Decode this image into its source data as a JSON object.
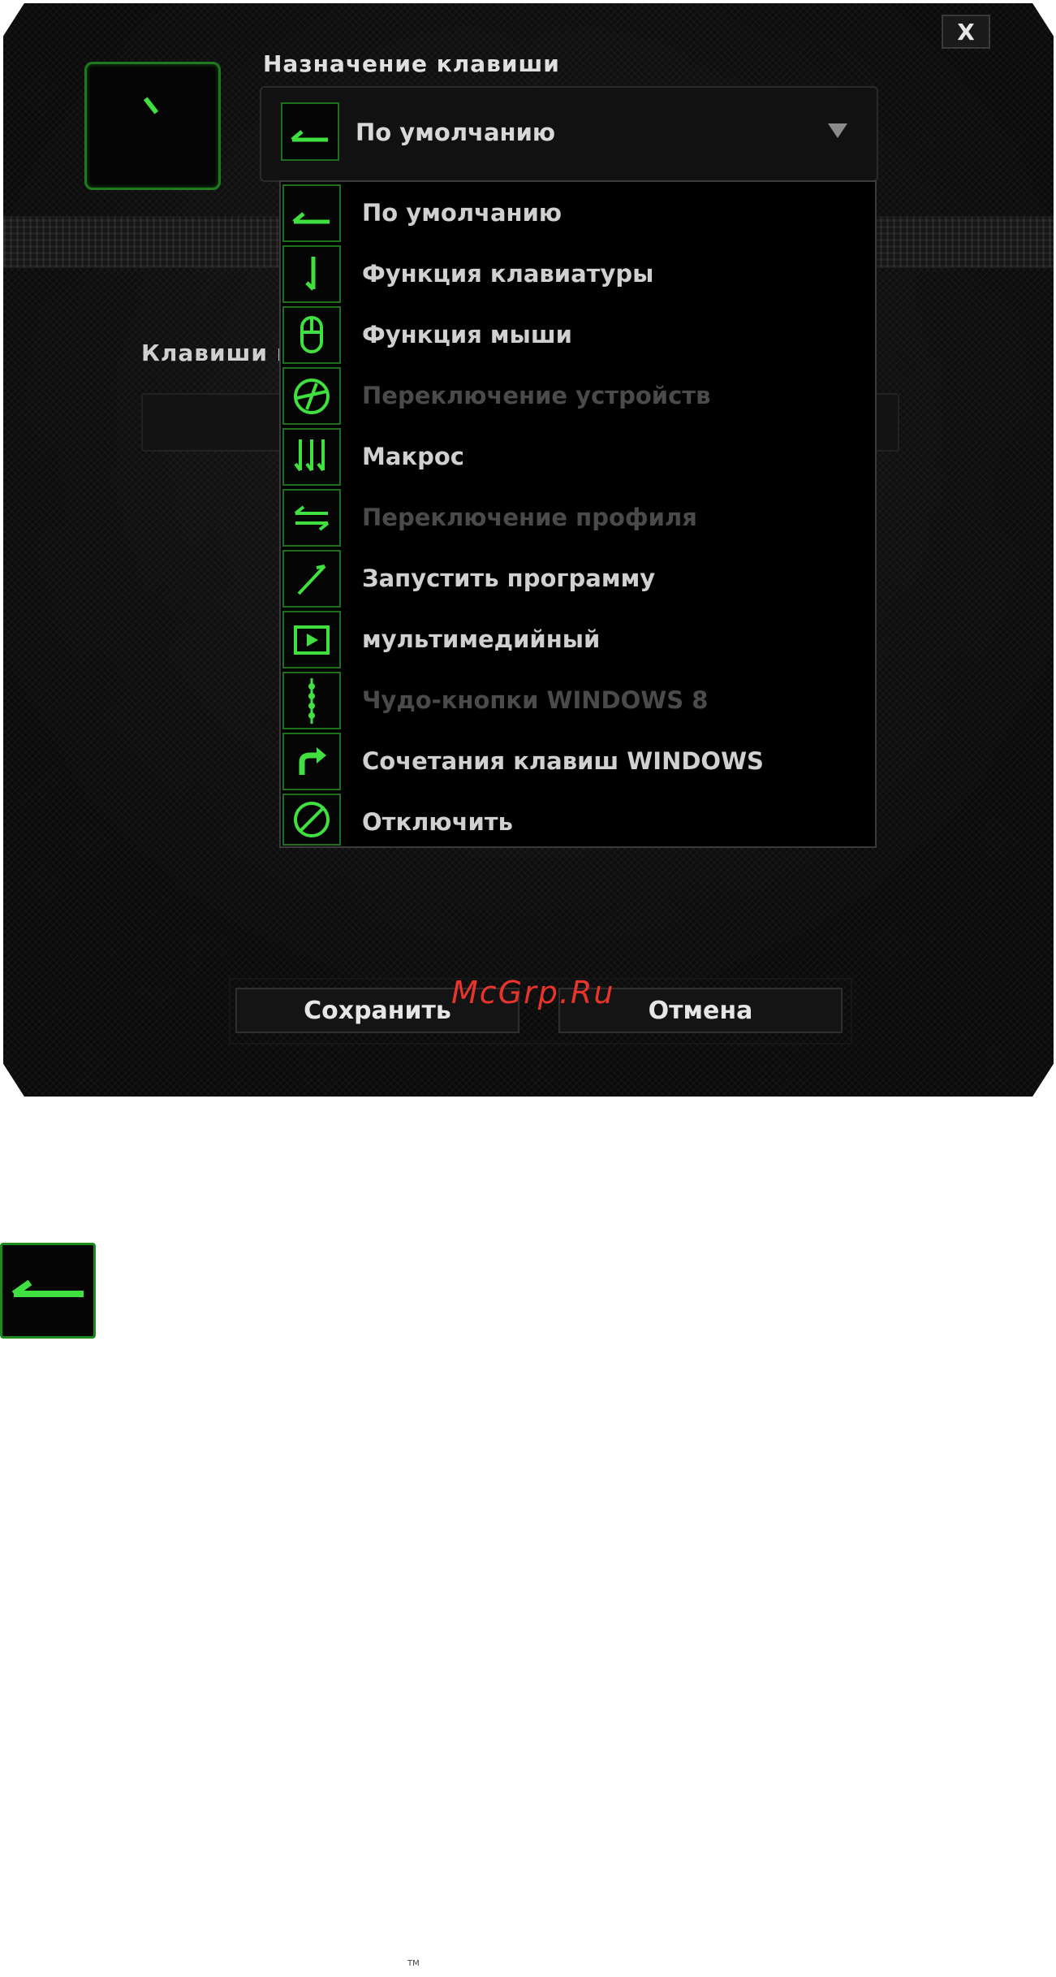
{
  "dialog": {
    "close_label": "X",
    "assign_title": "Назначение клавиши",
    "selected_value": "По умолчанию",
    "section_label": "Клавиши по",
    "save_label": "Сохранить",
    "cancel_label": "Отмена"
  },
  "menu": {
    "items": [
      {
        "label": "По умолчанию",
        "icon": "default-arrow-icon",
        "enabled": true
      },
      {
        "label": "Функция клавиатуры",
        "icon": "keyboard-function-icon",
        "enabled": true
      },
      {
        "label": "Функция мыши",
        "icon": "mouse-icon",
        "enabled": true
      },
      {
        "label": "Переключение устройств",
        "icon": "device-switch-icon",
        "enabled": false
      },
      {
        "label": "Макрос",
        "icon": "macro-icon",
        "enabled": true
      },
      {
        "label": "Переключение профиля",
        "icon": "profile-switch-icon",
        "enabled": false
      },
      {
        "label": "Запустить программу",
        "icon": "launch-program-icon",
        "enabled": true
      },
      {
        "label": "мультимедийный",
        "icon": "multimedia-play-icon",
        "enabled": true
      },
      {
        "label": "Чудо-кнопки WINDOWS 8",
        "icon": "charms-icon",
        "enabled": false
      },
      {
        "label": "Сочетания клавиш WINDOWS",
        "icon": "windows-shortcut-icon",
        "enabled": true
      },
      {
        "label": "Отключить",
        "icon": "disable-icon",
        "enabled": true
      }
    ]
  },
  "watermark": "McGrp.Ru",
  "footer": {
    "tm": "TM"
  },
  "colors": {
    "accent": "#3fe03f",
    "background": "#0b0b0b",
    "disabled_text": "#4a4a4a"
  }
}
